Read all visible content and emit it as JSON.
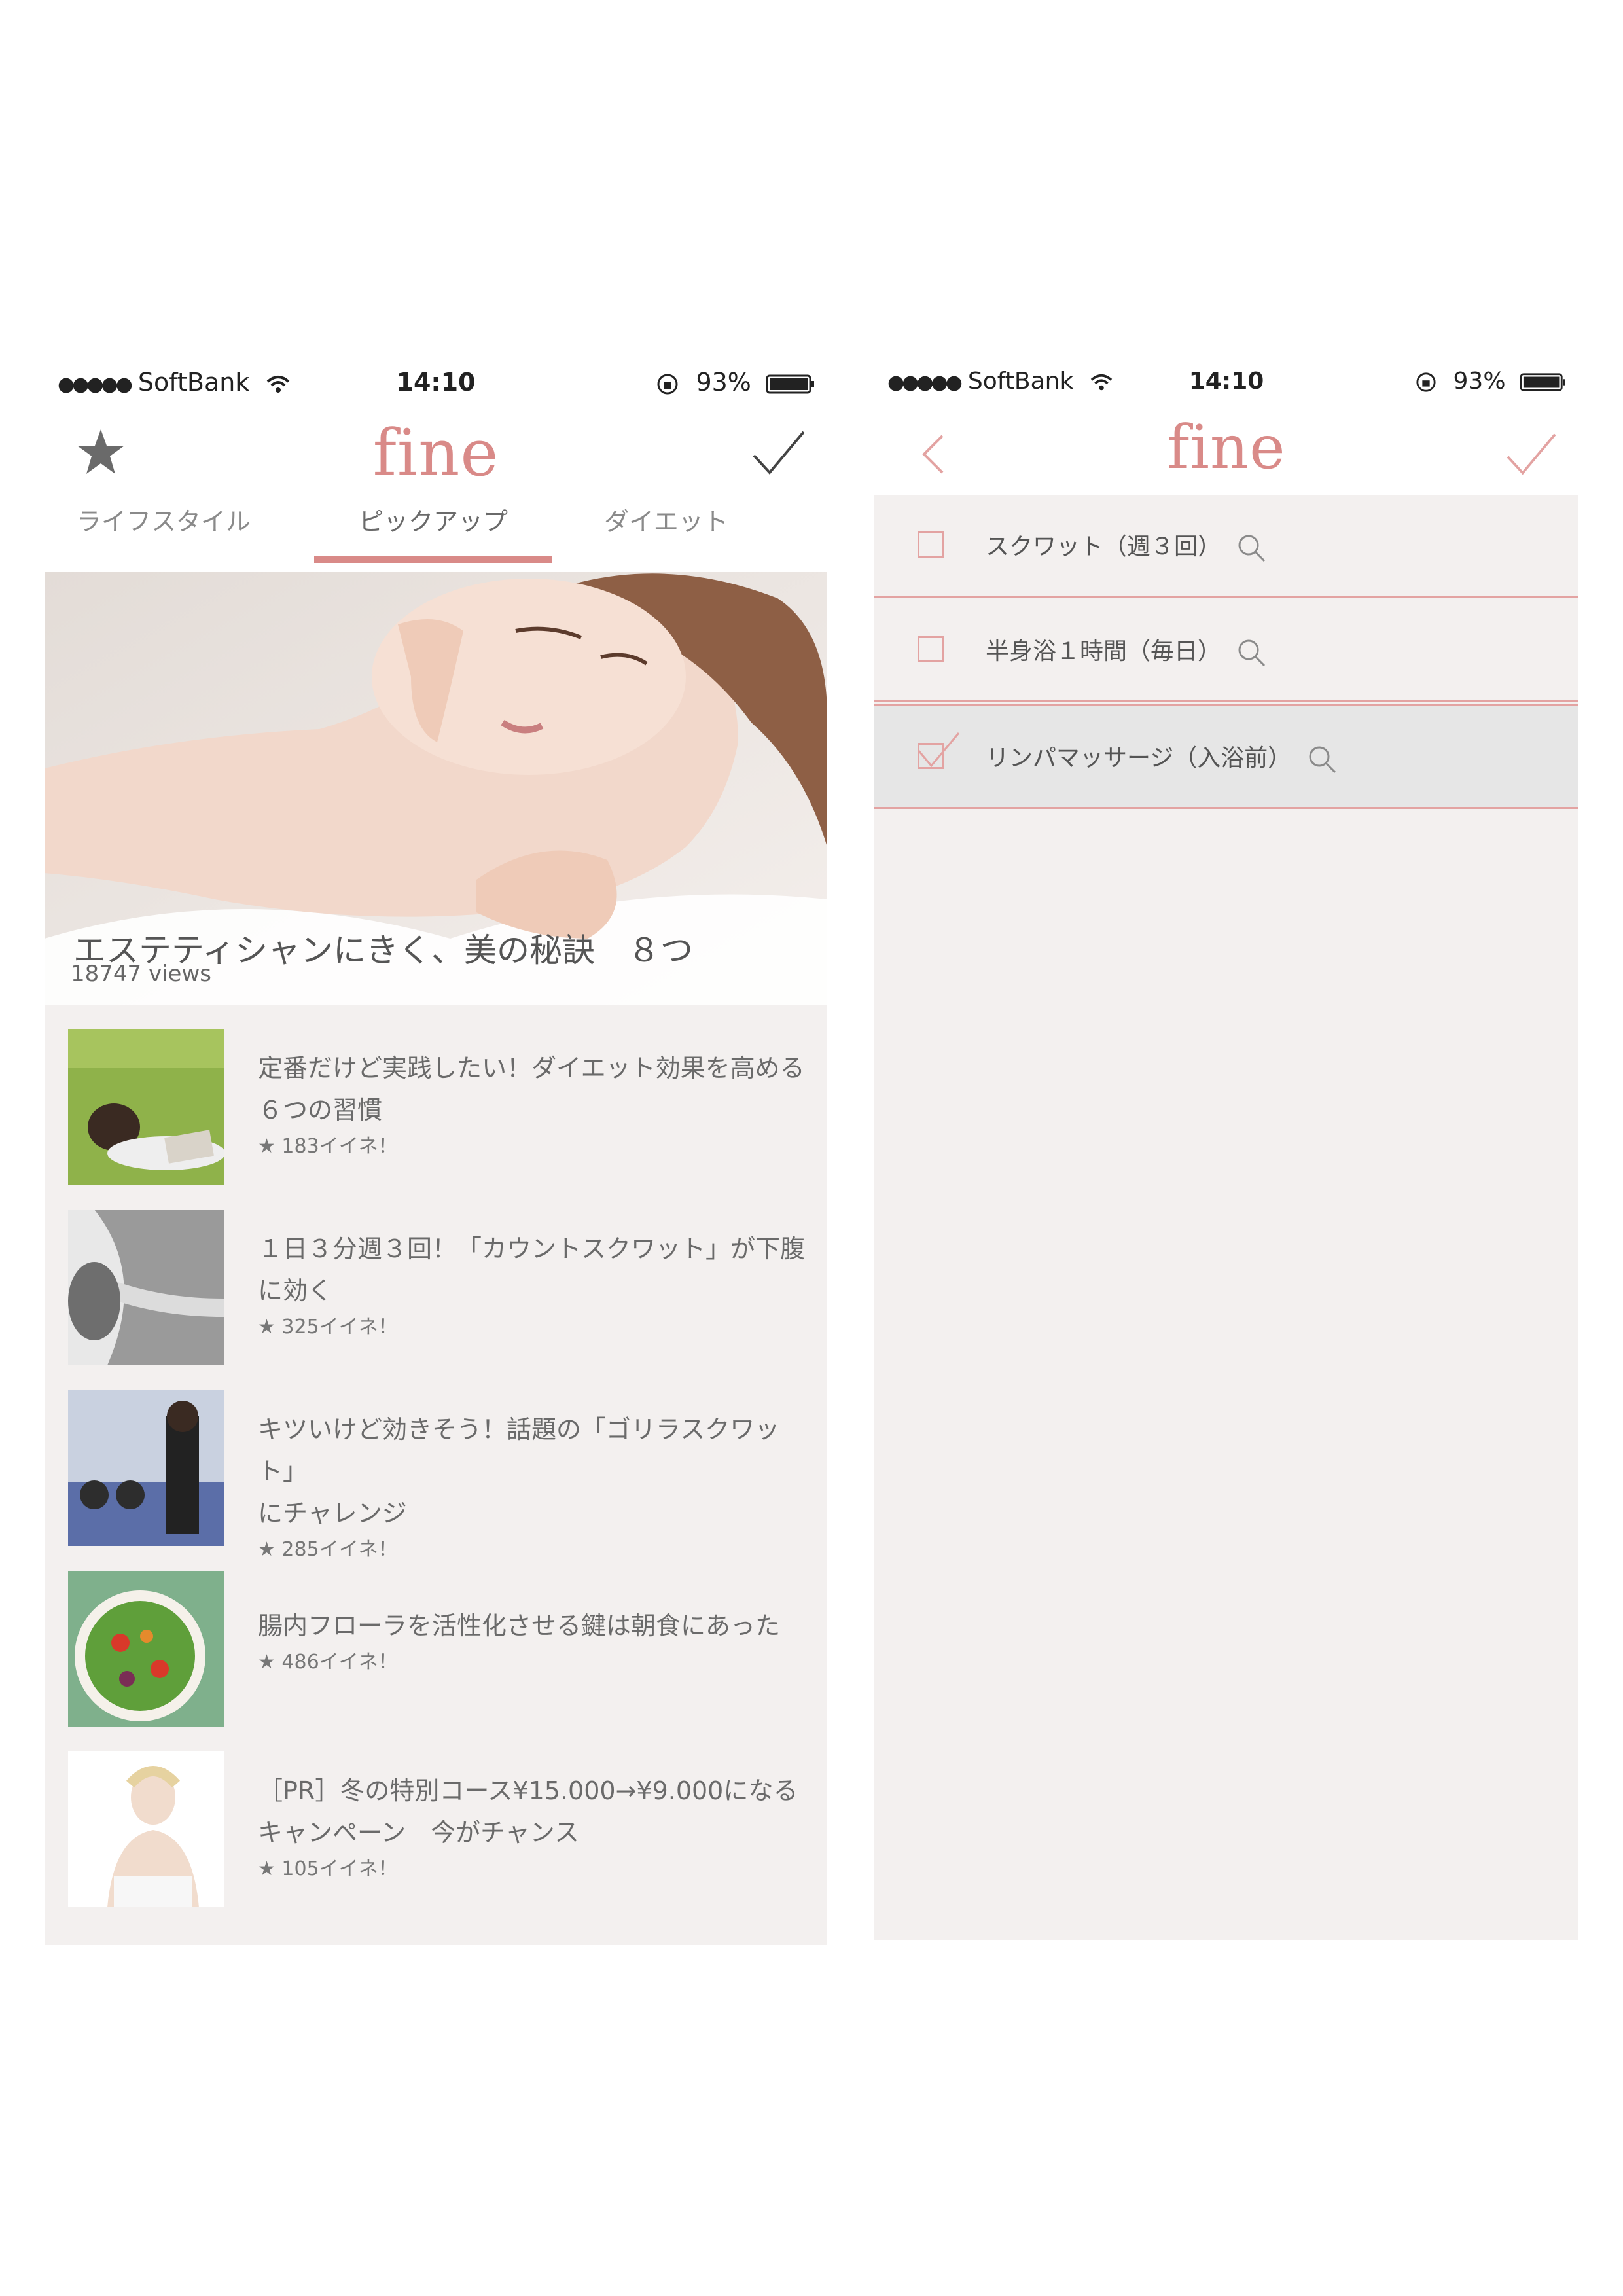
{
  "left_screen": {
    "status": {
      "carrier": "SoftBank",
      "time": "14:10",
      "battery": "93%"
    },
    "logo": "fine",
    "tabs": [
      {
        "label": "ライフスタイル"
      },
      {
        "label": "ピックアップ"
      },
      {
        "label": "ダイエット"
      }
    ],
    "active_tab": "ピックアップ",
    "hero": {
      "title": "エステティシャンにきく、美の秘訣　８つ",
      "views": "18747 views"
    },
    "articles": [
      {
        "title_line1": "定番だけど実践したい！ダイエット効果を高める",
        "title_line2": "６つの習慣",
        "likes": "★ 183イイネ！"
      },
      {
        "title_line1": "１日３分週３回！「カウントスクワット」が下腹",
        "title_line2": "に効く",
        "likes": "★ 325イイネ！"
      },
      {
        "title_line1": "キツいけど効きそう！話題の「ゴリラスクワット」",
        "title_line2": "にチャレンジ",
        "likes": "★ 285イイネ！"
      },
      {
        "title_line1": "腸内フローラを活性化させる鍵は朝食にあった",
        "title_line2": "",
        "likes": "★ 486イイネ！"
      },
      {
        "title_line1": "［PR］冬の特別コース¥15.000→¥9.000になる",
        "title_line2": "キャンペーン　今がチャンス",
        "likes": "★ 105イイネ！"
      }
    ]
  },
  "right_screen": {
    "status": {
      "carrier": "SoftBank",
      "time": "14:10",
      "battery": "93%"
    },
    "logo": "fine",
    "checklist": [
      {
        "label": "スクワット（週３回）",
        "checked": false
      },
      {
        "label": "半身浴１時間（毎日）",
        "checked": false
      },
      {
        "label": "リンパマッサージ（入浴前）",
        "checked": true
      }
    ]
  },
  "colors": {
    "accent": "#d98a88",
    "background": "#f3f0ef",
    "checked_row": "#e6e6e6",
    "icon_gray": "#6a6a6a"
  },
  "icons": [
    "star-icon",
    "checkmark-icon",
    "back-chevron-icon",
    "search-icon",
    "checkbox-icon",
    "wifi-icon",
    "battery-icon",
    "rotation-lock-icon"
  ]
}
